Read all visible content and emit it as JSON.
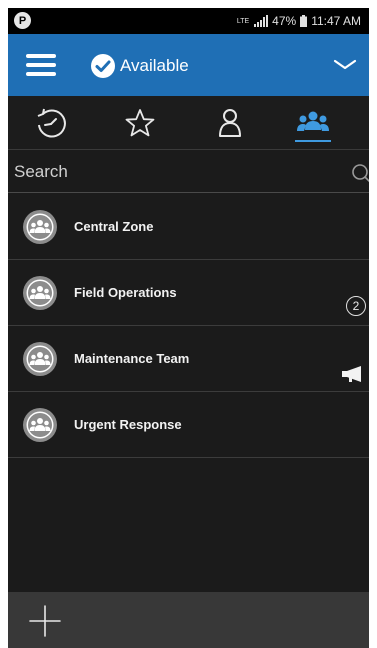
{
  "status_bar": {
    "left_badge": "P",
    "network": "LTE",
    "battery": "47%",
    "time": "11:47 AM"
  },
  "header": {
    "status_label": "Available"
  },
  "tabs": [
    {
      "id": "recent",
      "icon": "history-icon"
    },
    {
      "id": "favorites",
      "icon": "star-icon"
    },
    {
      "id": "contacts",
      "icon": "person-icon"
    },
    {
      "id": "groups",
      "icon": "group-icon",
      "active": true
    }
  ],
  "search": {
    "placeholder": "Search"
  },
  "groups": [
    {
      "name": "Central Zone"
    },
    {
      "name": "Field Operations",
      "badge": "2"
    },
    {
      "name": "Maintenance Team",
      "indicator": "megaphone-icon"
    },
    {
      "name": "Urgent Response"
    }
  ],
  "colors": {
    "header_bg": "#1f6fb5",
    "accent": "#3f9ae0",
    "background": "#1b1b1b",
    "bottom_bar": "#383838"
  }
}
